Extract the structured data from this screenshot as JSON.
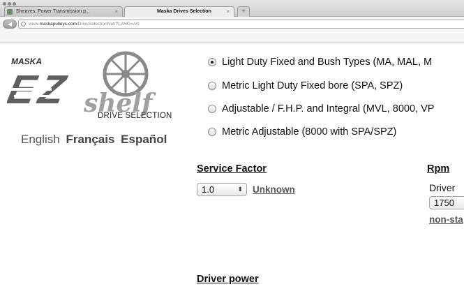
{
  "browser": {
    "tabs": [
      {
        "label": "Sheaves, Power Transmission p..."
      },
      {
        "label": "Maska Drives Selection"
      }
    ],
    "url_prefix": "www.",
    "url_domain": "maskapulleys.com",
    "url_path": "/DriveSelectionNet/?LANG=AN"
  },
  "logo": {
    "brand": "MASKA",
    "ez": "EZ",
    "shelf": "shelf",
    "subtitle": "DRIVE SELECTION"
  },
  "languages": [
    "English",
    "Français",
    "Español"
  ],
  "drive_types": [
    {
      "label": "Light Duty Fixed and Bush Types (MA, MAL, M",
      "checked": true
    },
    {
      "label": "Metric Light Duty Fixed bore (SPA, SPZ)",
      "checked": false
    },
    {
      "label": "Adjustable / F.H.P. and Integral (MVL, 8000, VP",
      "checked": false
    },
    {
      "label": "Metric Adjustable (8000 with SPA/SPZ)",
      "checked": false
    }
  ],
  "service_factor": {
    "heading": "Service Factor",
    "value": "1.0",
    "link": "Unknown"
  },
  "rpm": {
    "heading": "Rpm",
    "driver_label": "Driver",
    "driver_value": "1750",
    "link": "non-sta"
  },
  "driver_power": {
    "heading": "Driver power"
  },
  "colors": {
    "logo_gray": "#7a7a7a",
    "logo_dark": "#4a4a4a"
  }
}
